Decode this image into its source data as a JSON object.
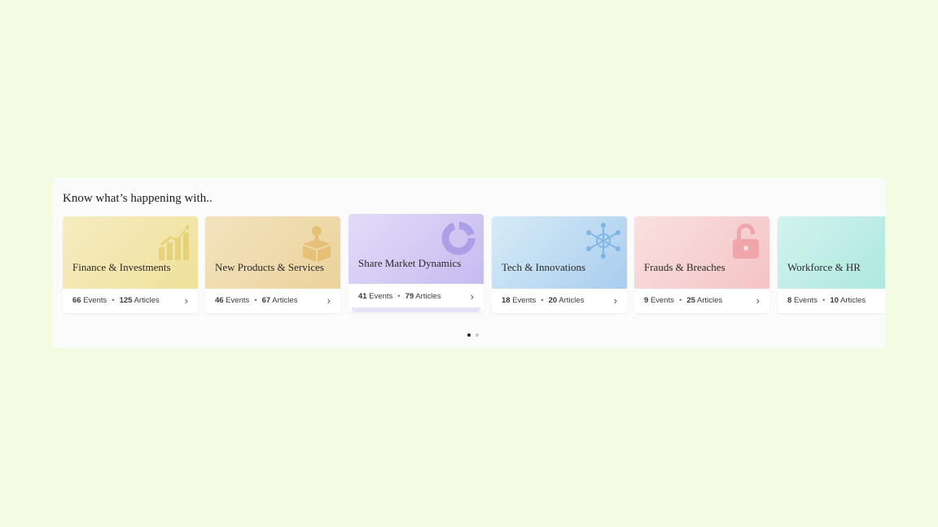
{
  "heading": "Know what’s happening with..",
  "events_label": "Events",
  "articles_label": "Articles",
  "cards": [
    {
      "title": "Finance & Investments",
      "events": "66",
      "articles": "125",
      "icon": "growth-chart-icon",
      "color": "#f1e6a7"
    },
    {
      "title": "New Products & Services",
      "events": "46",
      "articles": "67",
      "icon": "product-box-icon",
      "color": "#efd9a9"
    },
    {
      "title": "Share Market Dynamics",
      "events": "41",
      "articles": "79",
      "icon": "donut-chart-icon",
      "color": "#d2c8f3"
    },
    {
      "title": "Tech & Innovations",
      "events": "18",
      "articles": "20",
      "icon": "network-icon",
      "color": "#b8d9f1"
    },
    {
      "title": "Frauds & Breaches",
      "events": "9",
      "articles": "25",
      "icon": "padlock-icon",
      "color": "#f6cfd0"
    },
    {
      "title": "Workforce & HR",
      "events": "8",
      "articles": "10",
      "icon": "briefcase-icon",
      "color": "#bdeee6"
    }
  ],
  "pager": {
    "pages": 2,
    "active": 1
  }
}
